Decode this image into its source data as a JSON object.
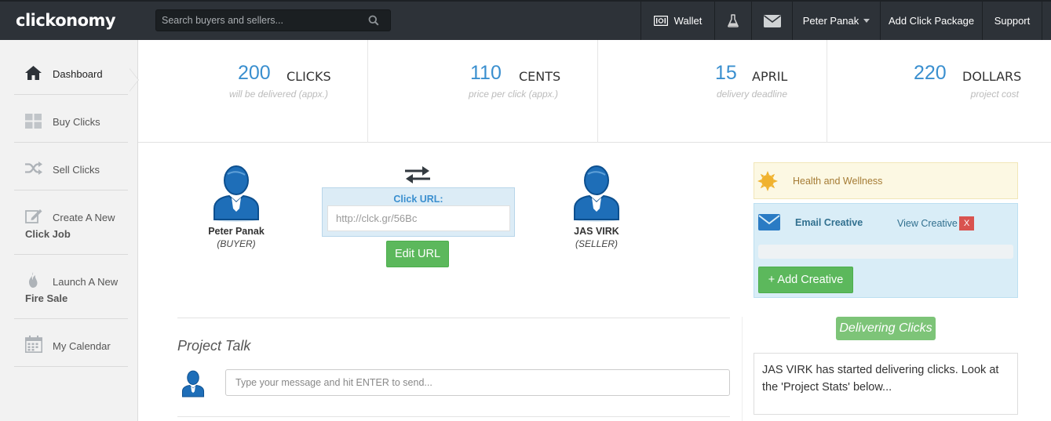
{
  "header": {
    "logo": "clickonomy",
    "search_placeholder": "Search buyers and sellers...",
    "wallet_label": "Wallet",
    "user_name": "Peter Panak",
    "add_click_package": "Add Click Package",
    "support": "Support"
  },
  "sidebar": {
    "items": [
      {
        "label": "Dashboard",
        "icon": "home-icon"
      },
      {
        "label": "Buy Clicks",
        "icon": "grid-icon"
      },
      {
        "label": "Sell Clicks",
        "icon": "shuffle-icon"
      },
      {
        "label": "Create A New",
        "label2": "Click Job",
        "icon": "edit-icon"
      },
      {
        "label": "Launch A New",
        "label2": "Fire Sale",
        "icon": "fire-icon"
      },
      {
        "label": "My Calendar",
        "icon": "calendar-icon"
      }
    ]
  },
  "stats": [
    {
      "value": "200",
      "unit": "CLICKS",
      "caption": "will be delivered (appx.)"
    },
    {
      "value": "110",
      "unit": "CENTS",
      "caption": "price per click (appx.)"
    },
    {
      "value": "15",
      "unit": "APRIL",
      "caption": "delivery deadline"
    },
    {
      "value": "220",
      "unit": "DOLLARS",
      "caption": "project cost"
    }
  ],
  "buyer": {
    "name": "Peter Panak",
    "role": "(BUYER)"
  },
  "seller": {
    "name": "JAS VIRK",
    "role": "(SELLER)"
  },
  "click_url": {
    "label": "Click URL:",
    "value": "http://clck.gr/56Bc",
    "edit_button": "Edit URL"
  },
  "project_talk": {
    "title": "Project Talk",
    "placeholder": "Type your message and hit ENTER to send..."
  },
  "category": {
    "label": "Health and Wellness"
  },
  "creative": {
    "title": "Email Creative",
    "view_link": "View Creative",
    "remove_label": "X",
    "add_button": "+ Add Creative"
  },
  "delivery": {
    "badge": "Delivering Clicks",
    "message": "JAS VIRK has started delivering clicks. Look at the 'Project Stats' below..."
  },
  "colors": {
    "topbar": "#2d3238",
    "accent_blue": "#3a8fcf",
    "green": "#5cb85c",
    "danger": "#d9534f"
  }
}
